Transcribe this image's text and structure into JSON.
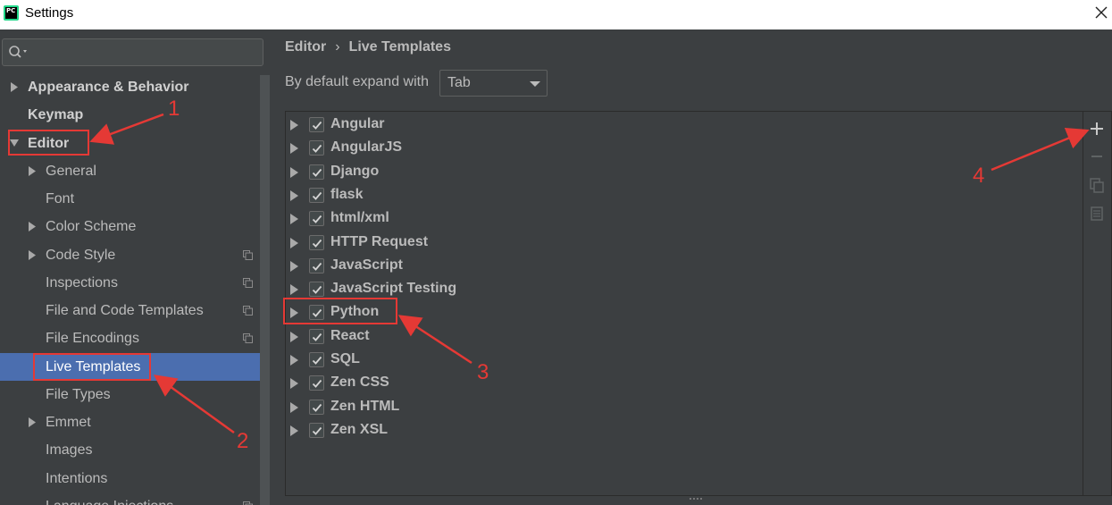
{
  "window": {
    "title": "Settings",
    "app_icon_text": "PC"
  },
  "sidebar": {
    "search": {
      "placeholder": "",
      "value": ""
    },
    "items": [
      {
        "label": "Appearance & Behavior",
        "expanded": false
      },
      {
        "label": "Keymap"
      },
      {
        "label": "Editor",
        "expanded": true
      },
      {
        "label": "General",
        "expanded": false
      },
      {
        "label": "Font"
      },
      {
        "label": "Color Scheme",
        "expanded": false
      },
      {
        "label": "Code Style",
        "expanded": false,
        "project_icon": true
      },
      {
        "label": "Inspections",
        "project_icon": true
      },
      {
        "label": "File and Code Templates",
        "project_icon": true
      },
      {
        "label": "File Encodings",
        "project_icon": true
      },
      {
        "label": "Live Templates",
        "selected": true
      },
      {
        "label": "File Types"
      },
      {
        "label": "Emmet",
        "expanded": false
      },
      {
        "label": "Images"
      },
      {
        "label": "Intentions"
      },
      {
        "label": "Language Injections",
        "project_icon": true
      }
    ]
  },
  "main": {
    "breadcrumb": [
      "Editor",
      "Live Templates"
    ],
    "breadcrumb_separator": "›",
    "expand_label": "By default expand with",
    "expand_value": "Tab",
    "template_groups": [
      {
        "label": "Angular",
        "checked": true
      },
      {
        "label": "AngularJS",
        "checked": true
      },
      {
        "label": "Django",
        "checked": true
      },
      {
        "label": "flask",
        "checked": true
      },
      {
        "label": "html/xml",
        "checked": true
      },
      {
        "label": "HTTP Request",
        "checked": true
      },
      {
        "label": "JavaScript",
        "checked": true
      },
      {
        "label": "JavaScript Testing",
        "checked": true
      },
      {
        "label": "Python",
        "checked": true
      },
      {
        "label": "React",
        "checked": true
      },
      {
        "label": "SQL",
        "checked": true
      },
      {
        "label": "Zen CSS",
        "checked": true
      },
      {
        "label": "Zen HTML",
        "checked": true
      },
      {
        "label": "Zen XSL",
        "checked": true
      }
    ],
    "toolbar": [
      "add-icon",
      "remove-icon",
      "copy-icon",
      "restore-defaults-icon"
    ]
  },
  "annotations": {
    "labels": [
      "1",
      "2",
      "3",
      "4"
    ],
    "color": "#e53935"
  },
  "colors": {
    "background": "#3c3f41",
    "selection": "#4b6eaf",
    "text": "#bbbbbb"
  }
}
